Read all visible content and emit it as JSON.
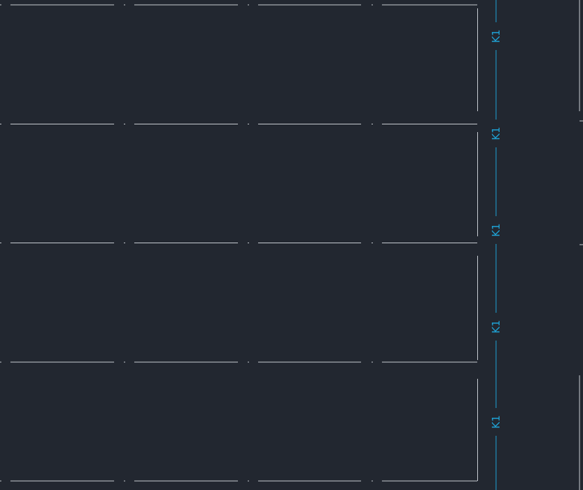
{
  "viewport": {
    "background": "#222730",
    "line_color": "#c8ccd2",
    "dim_color": "#1fa3d6"
  },
  "dimension_labels": [
    "K1",
    "K1",
    "K1",
    "K1",
    "K1"
  ]
}
